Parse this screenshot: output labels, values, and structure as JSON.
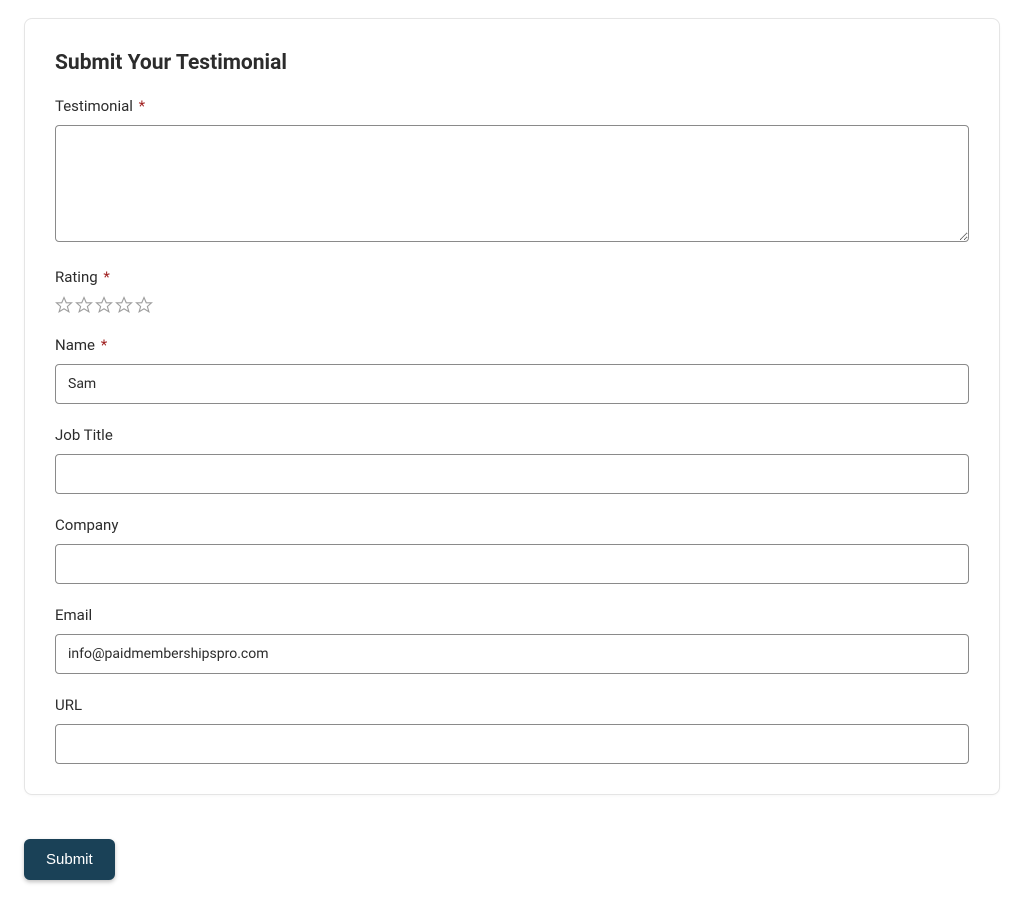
{
  "form": {
    "title": "Submit Your Testimonial",
    "required_mark": "*",
    "fields": {
      "testimonial": {
        "label": "Testimonial",
        "required": true,
        "value": ""
      },
      "rating": {
        "label": "Rating",
        "required": true,
        "value": 0,
        "max": 5
      },
      "name": {
        "label": "Name",
        "required": true,
        "value": "Sam"
      },
      "job_title": {
        "label": "Job Title",
        "required": false,
        "value": ""
      },
      "company": {
        "label": "Company",
        "required": false,
        "value": ""
      },
      "email": {
        "label": "Email",
        "required": false,
        "value": "info@paidmembershipspro.com"
      },
      "url": {
        "label": "URL",
        "required": false,
        "value": ""
      }
    },
    "submit_label": "Submit"
  },
  "colors": {
    "accent": "#1a4157",
    "required": "#a02020",
    "border": "#8a8a8a",
    "star_outline": "#9e9e9e"
  }
}
